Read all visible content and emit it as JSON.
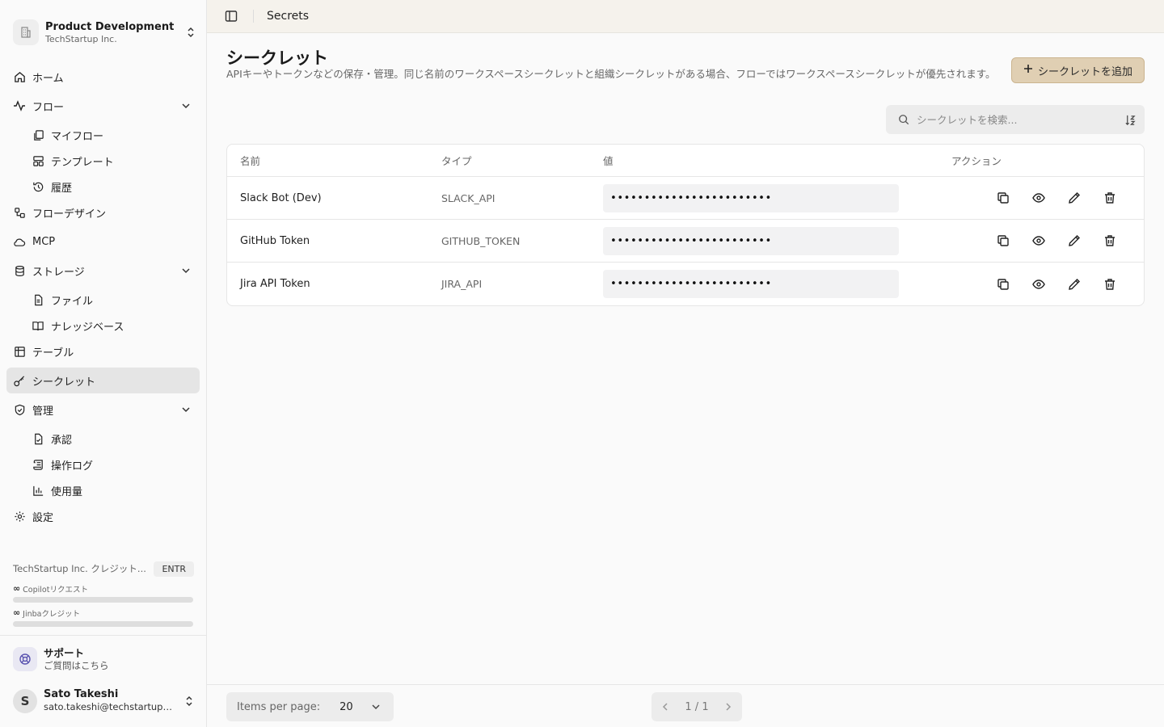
{
  "org": {
    "name": "Product Development",
    "sub": "TechStartup Inc."
  },
  "nav": {
    "home": "ホーム",
    "flow": "フロー",
    "my_flow": "マイフロー",
    "templates": "テンプレート",
    "history": "履歴",
    "flow_design": "フローデザイン",
    "mcp": "MCP",
    "storage": "ストレージ",
    "files": "ファイル",
    "knowledge": "ナレッジベース",
    "tables": "テーブル",
    "secrets": "シークレット",
    "admin": "管理",
    "approvals": "承認",
    "audit_log": "操作ログ",
    "usage": "使用量",
    "settings": "設定"
  },
  "credits": {
    "title": "TechStartup Inc. クレジット...",
    "plan": "ENTR",
    "copilot_label": "Copilotリクエスト",
    "jinba_label": "Jinbaクレジット",
    "infinity": "∞"
  },
  "support": {
    "title": "サポート",
    "sub": "ご質問はこちら"
  },
  "user": {
    "initial": "S",
    "name": "Sato Takeshi",
    "email": "sato.takeshi@techstartup.com"
  },
  "topbar": {
    "title": "Secrets"
  },
  "page": {
    "title": "シークレット",
    "description": "APIキーやトークンなどの保存・管理。同じ名前のワークスペースシークレットと組織シークレットがある場合、フローではワークスペースシークレットが優先されます。",
    "add_button": "シークレットを追加",
    "search_placeholder": "シークレットを検索..."
  },
  "table": {
    "headers": {
      "name": "名前",
      "type": "タイプ",
      "value": "値",
      "actions": "アクション"
    },
    "rows": [
      {
        "name": "Slack Bot (Dev)",
        "type": "SLACK_API",
        "value": "••••••••••••••••••••••••"
      },
      {
        "name": "GitHub Token",
        "type": "GITHUB_TOKEN",
        "value": "••••••••••••••••••••••••"
      },
      {
        "name": "Jira API Token",
        "type": "JIRA_API",
        "value": "••••••••••••••••••••••••"
      }
    ]
  },
  "footer": {
    "items_per_page_label": "Items per page:",
    "items_per_page": "20",
    "page_indicator": "1 / 1"
  }
}
